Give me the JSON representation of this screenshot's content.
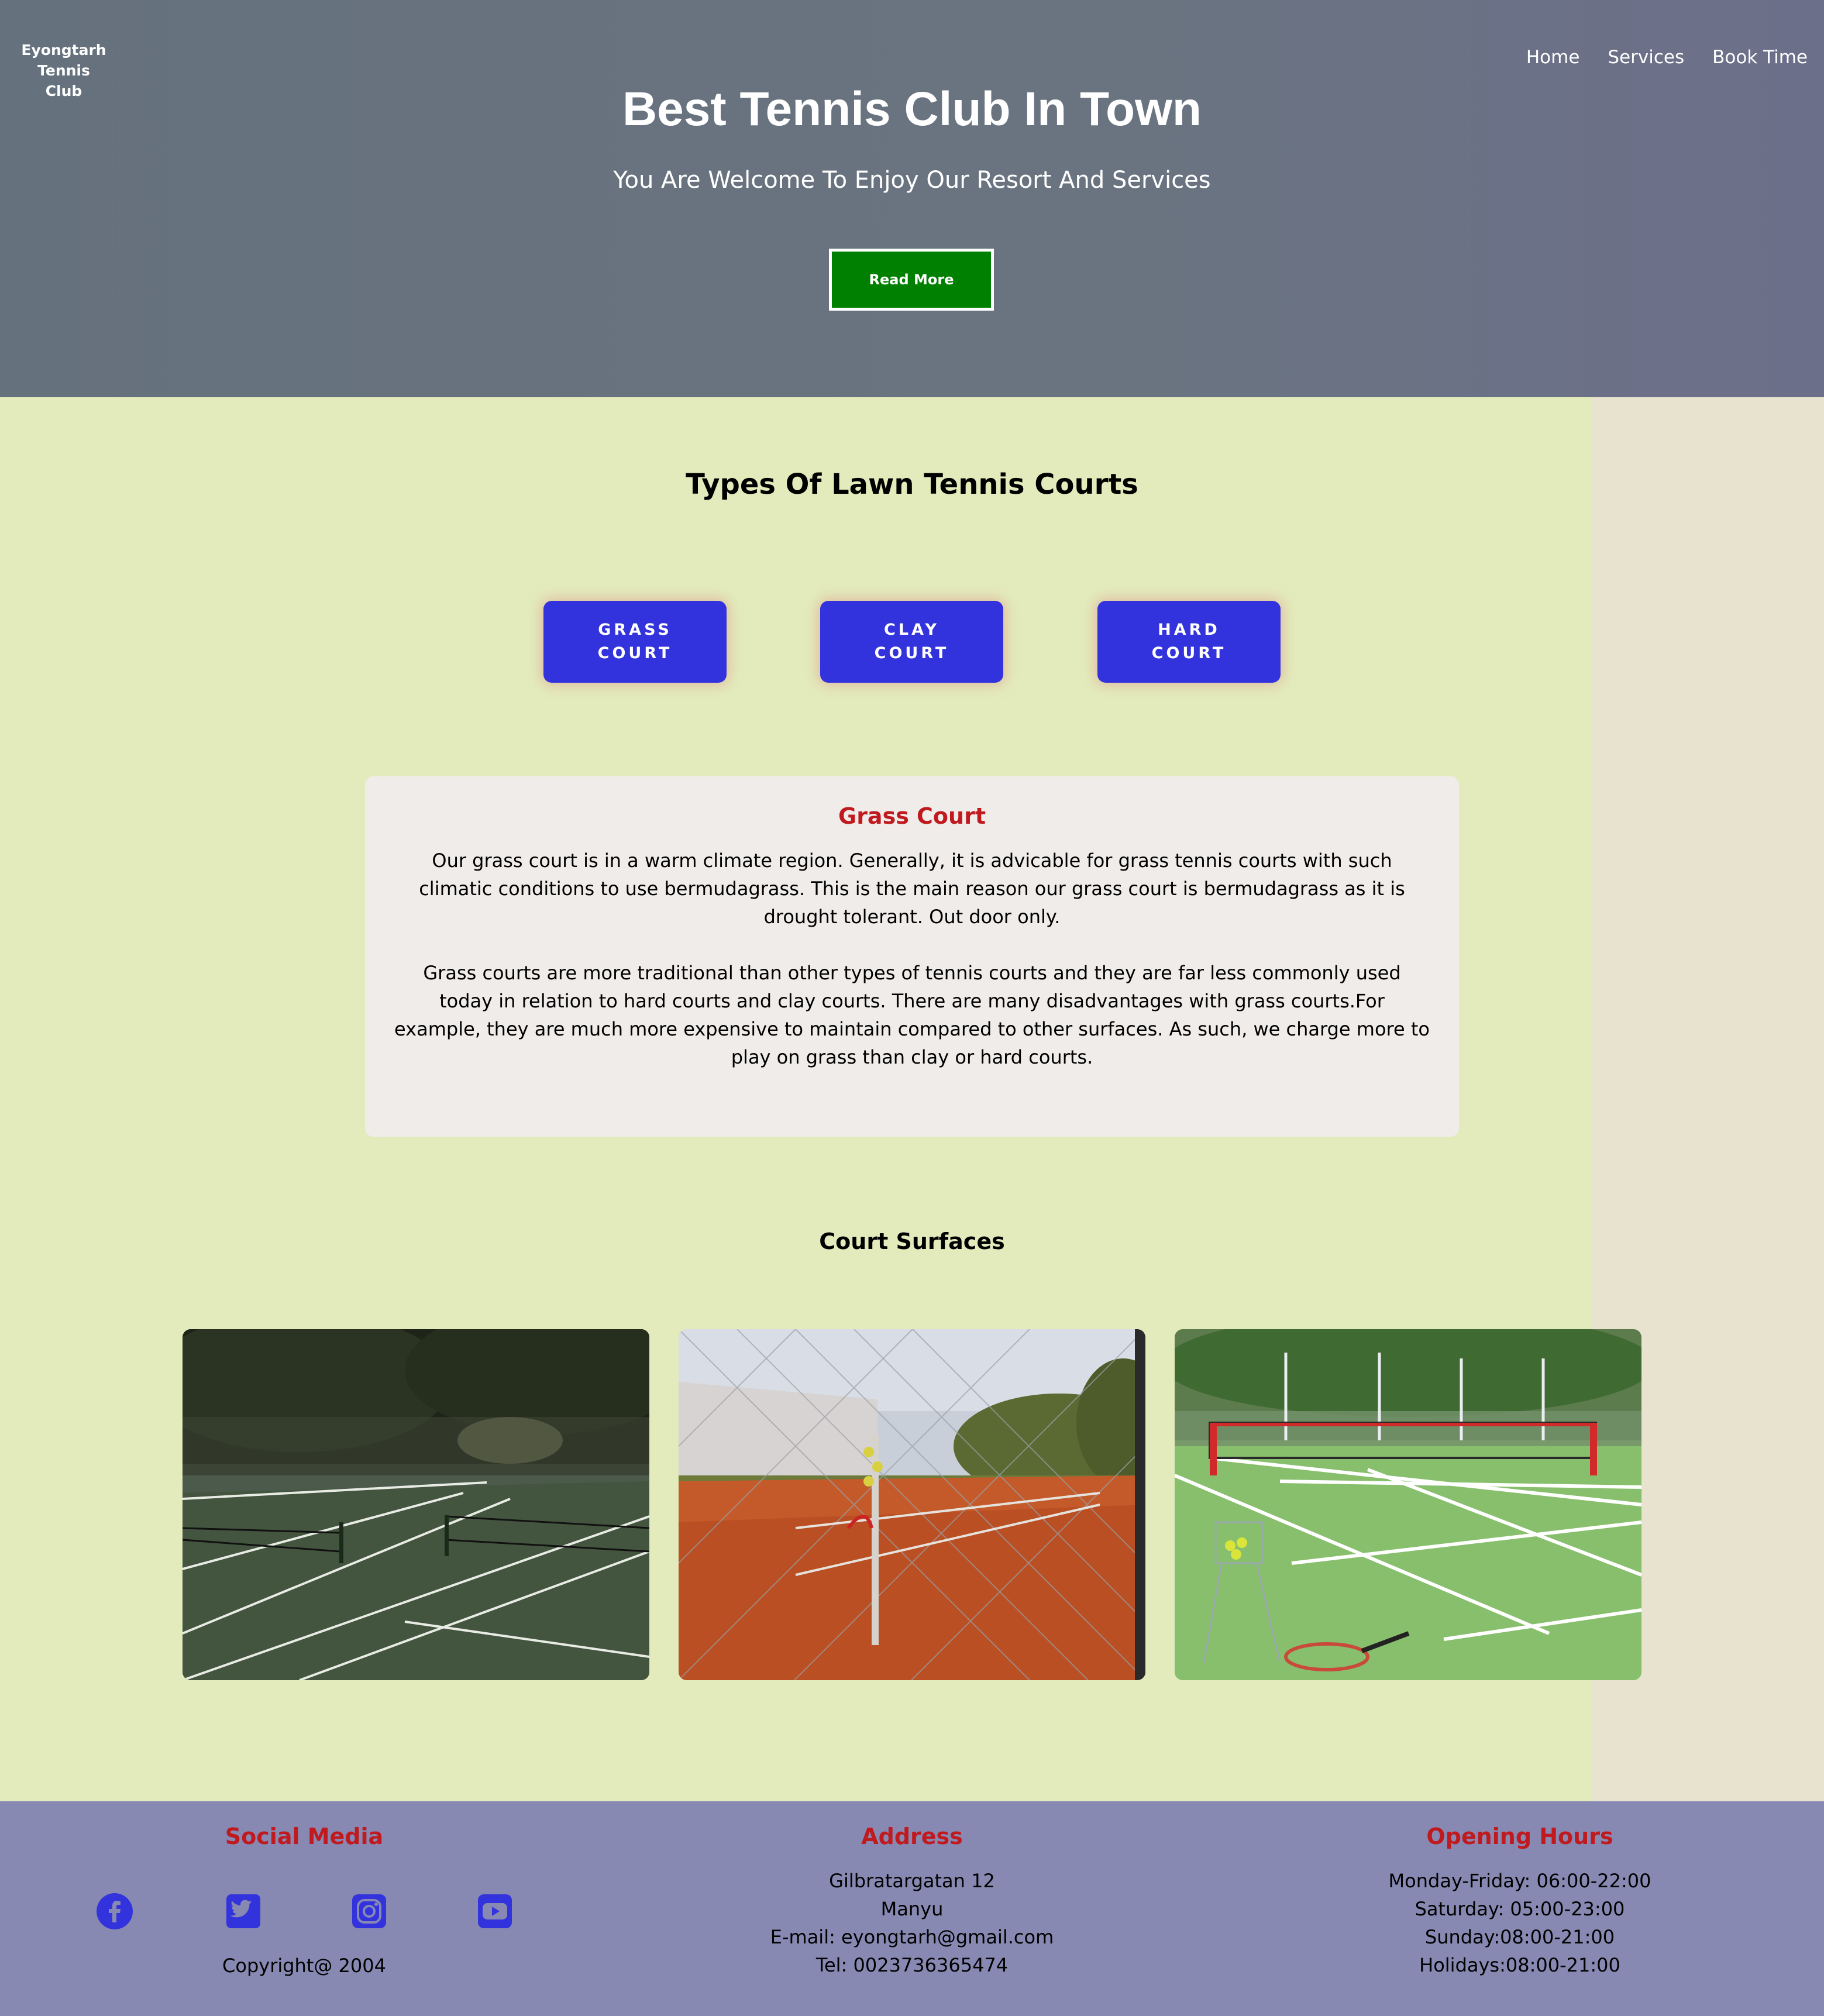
{
  "header": {
    "logo_line1": "Eyongtarh",
    "logo_line2": "Tennis Club",
    "nav": [
      "Home",
      "Services",
      "Book Time"
    ],
    "title": "Best Tennis Club In Town",
    "subtitle": "You Are Welcome To Enjoy Our Resort And Services",
    "cta_label": "Read More"
  },
  "types": {
    "title": "Types Of Lawn Tennis Courts",
    "buttons": [
      {
        "line1": "GRASS",
        "line2": "COURT"
      },
      {
        "line1": "CLAY",
        "line2": "COURT"
      },
      {
        "line1": "HARD",
        "line2": "COURT"
      }
    ]
  },
  "detail": {
    "title": "Grass Court",
    "paragraph1": "Our grass court is in a warm climate region. Generally, it is advicable for grass tennis courts with such climatic conditions to use bermudagrass. This is the main reason our grass court is bermudagrass as it is drought tolerant. Out door only.",
    "paragraph2": "Grass courts are more traditional than other types of tennis courts and they are far less commonly used today in relation to hard courts and clay courts. There are many disadvantages with grass courts.For example, they are much more expensive to maintain compared to other surfaces. As such, we charge more to play on grass than clay or hard courts."
  },
  "surfaces": {
    "title": "Court Surfaces"
  },
  "footer": {
    "social_title": "Social Media",
    "social_icons": [
      "facebook-icon",
      "twitter-icon",
      "instagram-icon",
      "youtube-icon"
    ],
    "copyright": "Copyright@ 2004",
    "address_title": "Address",
    "address_lines": [
      "Gilbratargatan 12",
      "Manyu",
      "E-mail: eyongtarh@gmail.com",
      "Tel: 0023736365474"
    ],
    "hours_title": "Opening Hours",
    "hours_lines": [
      "Monday-Friday: 06:00-22:00",
      "Saturday: 05:00-23:00",
      "Sunday:08:00-21:00",
      "Holidays:08:00-21:00"
    ]
  },
  "colors": {
    "accent_button": "#3333dd",
    "cta_green": "#008000",
    "heading_red": "#c0191e",
    "page_bg": "#e3ebbc",
    "footer_bg": "#8789b2"
  }
}
